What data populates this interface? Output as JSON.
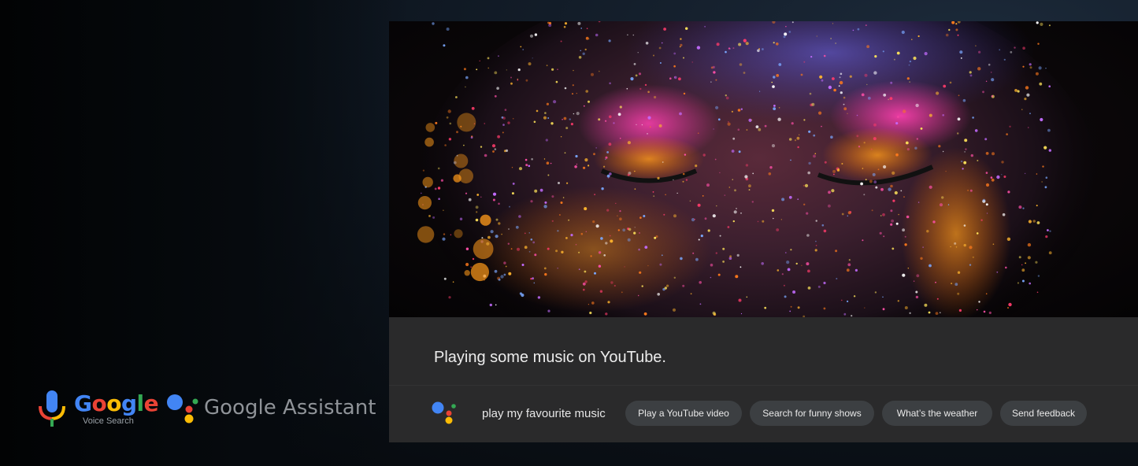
{
  "logos": {
    "voice_search": {
      "brand": "Google",
      "subtitle": "Voice Search",
      "icon": "microphone-icon",
      "letter_colors": [
        "#4285F4",
        "#EA4335",
        "#FBBC05",
        "#4285F4",
        "#34A853",
        "#EA4335"
      ]
    },
    "assistant": {
      "label": "Google Assistant",
      "icon": "assistant-dots-icon"
    }
  },
  "screen": {
    "image": "paint-splattered-face-photo",
    "response_text": "Playing some music on YouTube.",
    "query_text": "play my favourite music",
    "suggestions": [
      "Play a YouTube video",
      "Search for funny shows",
      "What’s the weather",
      "Send feedback"
    ]
  },
  "colors": {
    "google_blue": "#4285F4",
    "google_red": "#EA4335",
    "google_yellow": "#FBBC05",
    "google_green": "#34A853",
    "panel_bg": "#2a2a2b",
    "chip_bg": "#3c3f42"
  }
}
